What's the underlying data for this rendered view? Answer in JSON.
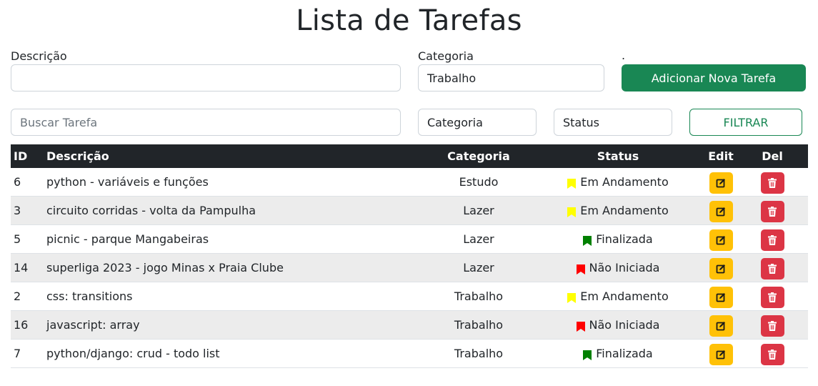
{
  "title": "Lista de Tarefas",
  "form": {
    "descricao_label": "Descrição",
    "descricao_value": "",
    "categoria_label": "Categoria",
    "categoria_value": "Trabalho",
    "dot_label": ".",
    "add_button": "Adicionar Nova Tarefa"
  },
  "filter": {
    "search_placeholder": "Buscar Tarefa",
    "categoria_value": "Categoria",
    "status_value": "Status",
    "filter_button": "FILTRAR"
  },
  "table": {
    "headers": {
      "id": "ID",
      "descricao": "Descrição",
      "categoria": "Categoria",
      "status": "Status",
      "edit": "Edit",
      "del": "Del"
    },
    "rows": [
      {
        "id": "6",
        "descricao": "python - variáveis e funções",
        "categoria": "Estudo",
        "status": "Em Andamento"
      },
      {
        "id": "3",
        "descricao": "circuito corridas - volta da Pampulha",
        "categoria": "Lazer",
        "status": "Em Andamento"
      },
      {
        "id": "5",
        "descricao": "picnic - parque Mangabeiras",
        "categoria": "Lazer",
        "status": "Finalizada"
      },
      {
        "id": "14",
        "descricao": "superliga 2023 - jogo Minas x Praia Clube",
        "categoria": "Lazer",
        "status": "Não Iniciada"
      },
      {
        "id": "2",
        "descricao": "css: transitions",
        "categoria": "Trabalho",
        "status": "Em Andamento"
      },
      {
        "id": "16",
        "descricao": "javascript: array",
        "categoria": "Trabalho",
        "status": "Não Iniciada"
      },
      {
        "id": "7",
        "descricao": "python/django: crud - todo list",
        "categoria": "Trabalho",
        "status": "Finalizada"
      }
    ]
  },
  "colors": {
    "add_button": "#198754",
    "header_bg": "#212529",
    "edit_button": "#ffc107",
    "delete_button": "#dc3545",
    "status_em_andamento": "#ffff00",
    "status_finalizada": "#008000",
    "status_nao_iniciada": "#ff0000"
  }
}
